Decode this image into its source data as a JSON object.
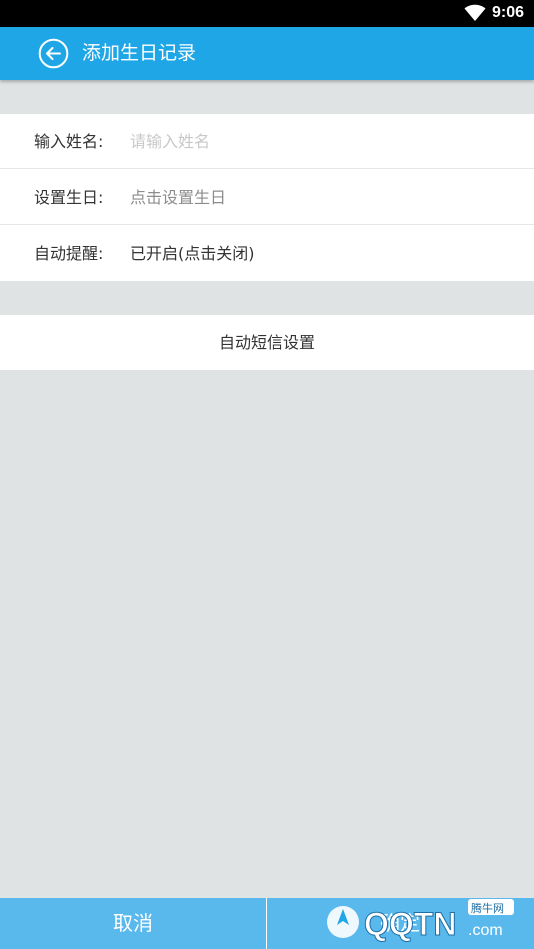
{
  "status_bar": {
    "time": "9:06",
    "wifi_icon": "wifi-icon"
  },
  "app_bar": {
    "back_icon": "back-arrow-circle-icon",
    "title": "添加生日记录"
  },
  "form": {
    "name": {
      "label": "输入姓名:",
      "placeholder": "请输入姓名",
      "value": ""
    },
    "birthday": {
      "label": "设置生日:",
      "value": "点击设置生日"
    },
    "reminder": {
      "label": "自动提醒:",
      "value": "已开启(点击关闭)"
    }
  },
  "sms_settings_label": "自动短信设置",
  "bottom_bar": {
    "cancel_label": "取消",
    "confirm_label": "确定"
  },
  "watermark": {
    "brand": "QQTN",
    "suffix": ".com",
    "badge": "腾牛网"
  },
  "colors": {
    "app_bar": "#1fa6e6",
    "bottom_bar": "#5ab9ec",
    "background": "#dfe3e4"
  }
}
